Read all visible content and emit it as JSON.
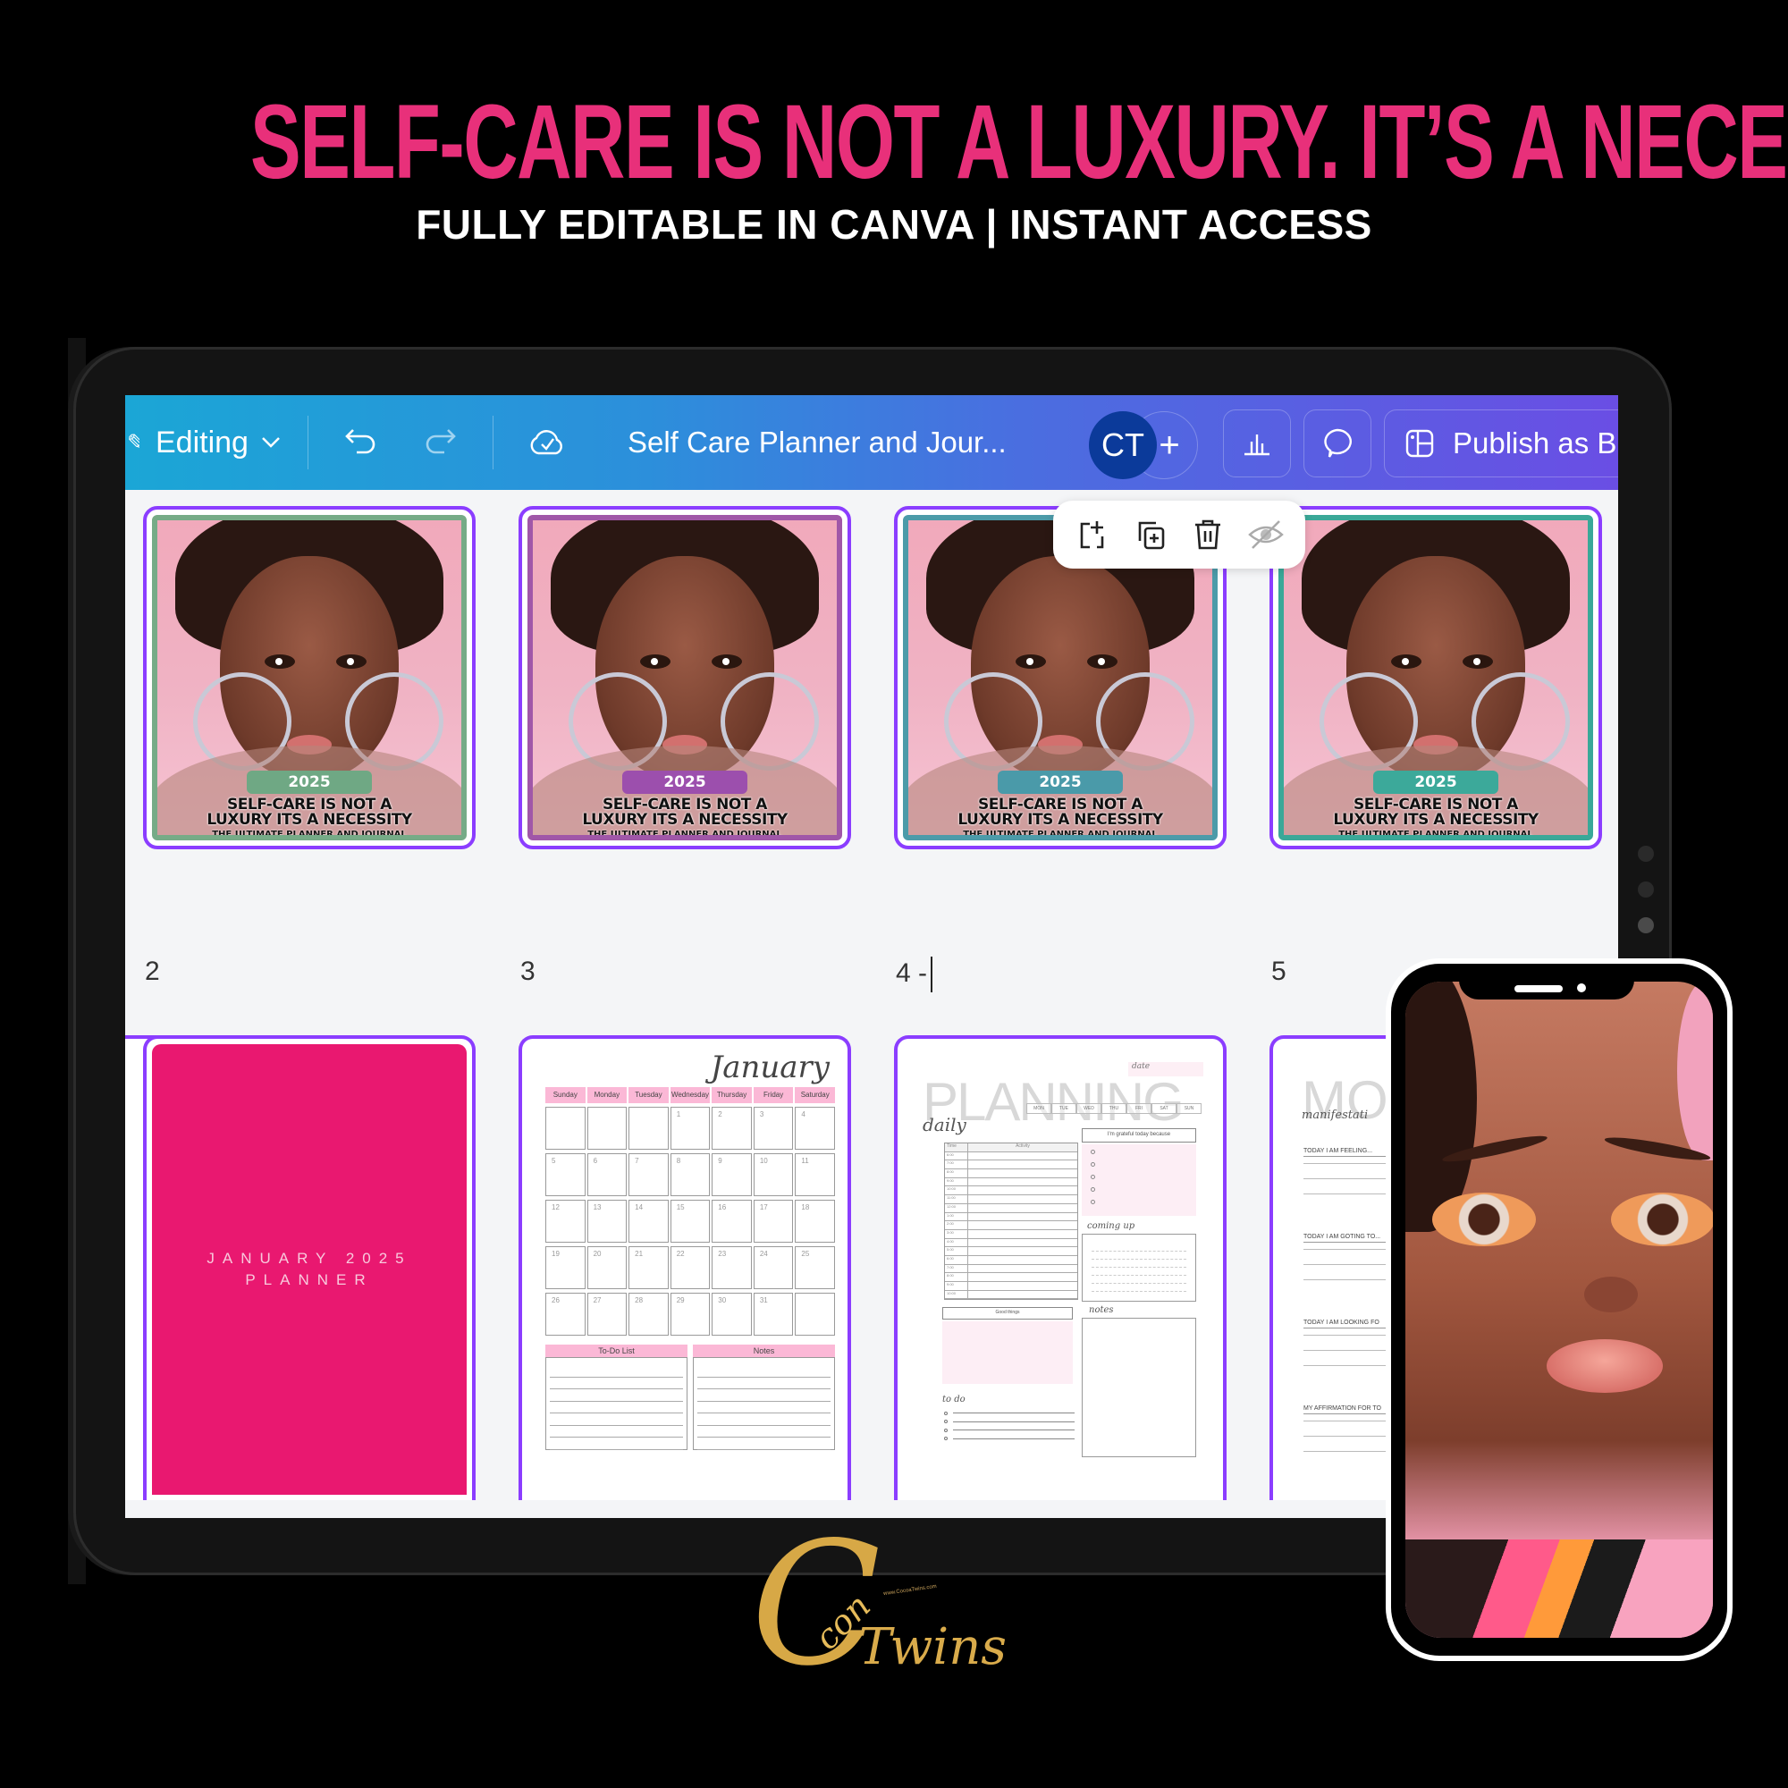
{
  "headline": "SELF-CARE IS NOT A LUXURY.  IT’S A NECESSITY.",
  "subheadline": "FULLY EDITABLE IN CANVA | INSTANT ACCESS",
  "colors": {
    "headline": "#e8307a",
    "toolbar_gradient_start": "#1ba6d6",
    "toolbar_gradient_end": "#6a4ee4",
    "selection_border": "#8b3dff",
    "avatar_bg": "#0b3a9a",
    "january_cover": "#e91870",
    "calendar_header": "#fbb8d6"
  },
  "toolbar": {
    "edit_icon": "pencil-icon",
    "mode_label": "Editing",
    "mode_chevron": "chevron-down-icon",
    "undo_icon": "undo-icon",
    "redo_icon": "redo-icon",
    "save_status_icon": "cloud-check-icon",
    "document_title": "Self Care Planner and Jour...",
    "avatar_initials": "CT",
    "add_collaborator": "+",
    "insights_icon": "bar-chart-icon",
    "comments_icon": "comment-icon",
    "publish_icon": "publish-layout-icon",
    "publish_label": "Publish as B"
  },
  "floating_page_tools": [
    {
      "name": "add-page",
      "icon": "add-page-icon"
    },
    {
      "name": "duplicate-page",
      "icon": "duplicate-icon"
    },
    {
      "name": "delete-page",
      "icon": "trash-icon"
    },
    {
      "name": "hide-page",
      "icon": "eye-off-icon"
    }
  ],
  "pages_row1": [
    {
      "number": "2",
      "frame_color": "#76ab87",
      "badge_color": "#6fa884",
      "year": "2025",
      "title_line1": "SELF-CARE IS NOT A",
      "title_line2": "LUXURY ITS A NECESSITY",
      "subtitle": "THE ULTIMATE PLANNER AND JOURNAL"
    },
    {
      "number": "3",
      "frame_color": "#a057a8",
      "badge_color": "#9c4fad",
      "year": "2025",
      "title_line1": "SELF-CARE IS NOT A",
      "title_line2": "LUXURY ITS A NECESSITY",
      "subtitle": "THE ULTIMATE PLANNER AND JOURNAL"
    },
    {
      "number": "4 -",
      "frame_color": "#4c9ba9",
      "badge_color": "#4a9aa9",
      "year": "2025",
      "title_line1": "SELF-CARE IS NOT A",
      "title_line2": "LUXURY ITS A NECESSITY",
      "subtitle": "THE ULTIMATE PLANNER AND JOURNAL"
    },
    {
      "number": "5",
      "frame_color": "#3aa898",
      "badge_color": "#3ca99a",
      "year": "2025",
      "title_line1": "SELF-CARE IS NOT A",
      "title_line2": "LUXURY ITS A NECESSITY",
      "subtitle": "THE ULTIMATE PLANNER AND JOURNAL"
    }
  ],
  "january_cover": {
    "line1": "JANUARY 2025",
    "line2": "PLANNER"
  },
  "calendar": {
    "month": "January",
    "weekdays": [
      "Sunday",
      "Monday",
      "Tuesday",
      "Wednesday",
      "Thursday",
      "Friday",
      "Saturday"
    ],
    "days": [
      "",
      "",
      "",
      "1",
      "2",
      "3",
      "4",
      "5",
      "6",
      "7",
      "8",
      "9",
      "10",
      "11",
      "12",
      "13",
      "14",
      "15",
      "16",
      "17",
      "18",
      "19",
      "20",
      "21",
      "22",
      "23",
      "24",
      "25",
      "26",
      "27",
      "28",
      "29",
      "30",
      "31",
      ""
    ],
    "todo_label": "To-Do List",
    "notes_label": "Notes"
  },
  "daily_planner": {
    "big_title": "PLANNING",
    "script_title": "daily",
    "date_label": "date",
    "weekdays": [
      "MON",
      "TUE",
      "WED",
      "THU",
      "FRI",
      "SAT",
      "SUN"
    ],
    "grateful_label": "I'm grateful today because",
    "time_header": "Time",
    "activity_header": "Activity",
    "times": [
      "6:00",
      "7:00",
      "8:00",
      "9:00",
      "10:00",
      "11:00",
      "12:00",
      "1:00",
      "2:00",
      "3:00",
      "4:00",
      "5:00",
      "6:00",
      "7:00",
      "8:00",
      "9:00",
      "10:00"
    ],
    "coming_up_label": "coming up",
    "good_things_label": "Good things",
    "notes_label": "notes",
    "todo_label": "to do"
  },
  "manifestation_page": {
    "big_title": "MO",
    "script_title": "manifestati",
    "prompts": [
      "TODAY I AM FEELING...",
      "TODAY I AM GOTING TO...",
      "TODAY I AM LOOKING FO",
      "MY AFFIRMATION FOR TO"
    ]
  },
  "logo": {
    "mark": "C",
    "word1": "con",
    "word2": "Twins",
    "url": "www.CocoaTwins.com"
  }
}
